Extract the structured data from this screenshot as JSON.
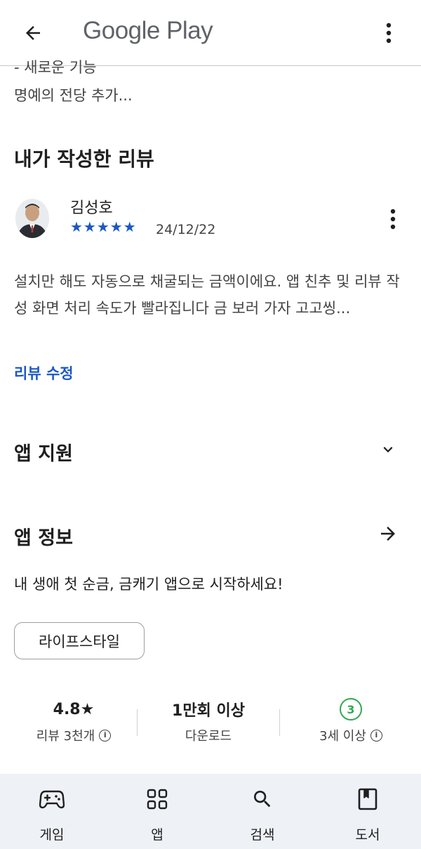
{
  "header": {
    "back_icon": "arrow-back-icon",
    "logo_text": "Google Play",
    "more_icon": "more-vert-icon"
  },
  "whats_new": {
    "cutoff_text": "- 새로운 기능",
    "last_line": "명예의 전당 추가..."
  },
  "my_review": {
    "section_title": "내가 작성한 리뷰",
    "reviewer_name": "김성호",
    "stars": "★★★★★",
    "rating": 5,
    "date": "24/12/22",
    "body": "설치만 해도 자동으로 채굴되는 금액이에요. 앱 친추 및 리뷰 작성 화면 처리 속도가 빨라집니다 금 보러 가자 고고씽...",
    "edit_label": "리뷰 수정"
  },
  "app_support": {
    "title": "앱 지원",
    "icon": "chevron-down-icon"
  },
  "app_info": {
    "title": "앱 정보",
    "icon": "arrow-forward-icon",
    "description": "내 생애 첫 순금, 금캐기 앱으로 시작하세요!",
    "category_chip": "라이프스타일"
  },
  "stats": {
    "rating_value": "4.8★",
    "rating_label": "리뷰 3천개",
    "downloads_value": "1만회 이상",
    "downloads_label": "다운로드",
    "age_badge": "3",
    "age_label": "3세 이상",
    "info_glyph": "i"
  },
  "bottom_nav": {
    "items": [
      {
        "label": "게임",
        "icon": "gamepad-icon"
      },
      {
        "label": "앱",
        "icon": "apps-grid-icon"
      },
      {
        "label": "검색",
        "icon": "search-icon"
      },
      {
        "label": "도서",
        "icon": "book-icon"
      }
    ]
  },
  "colors": {
    "accent_blue": "#1a57c9",
    "age_green": "#34a853",
    "nav_background": "#eef1f6"
  }
}
